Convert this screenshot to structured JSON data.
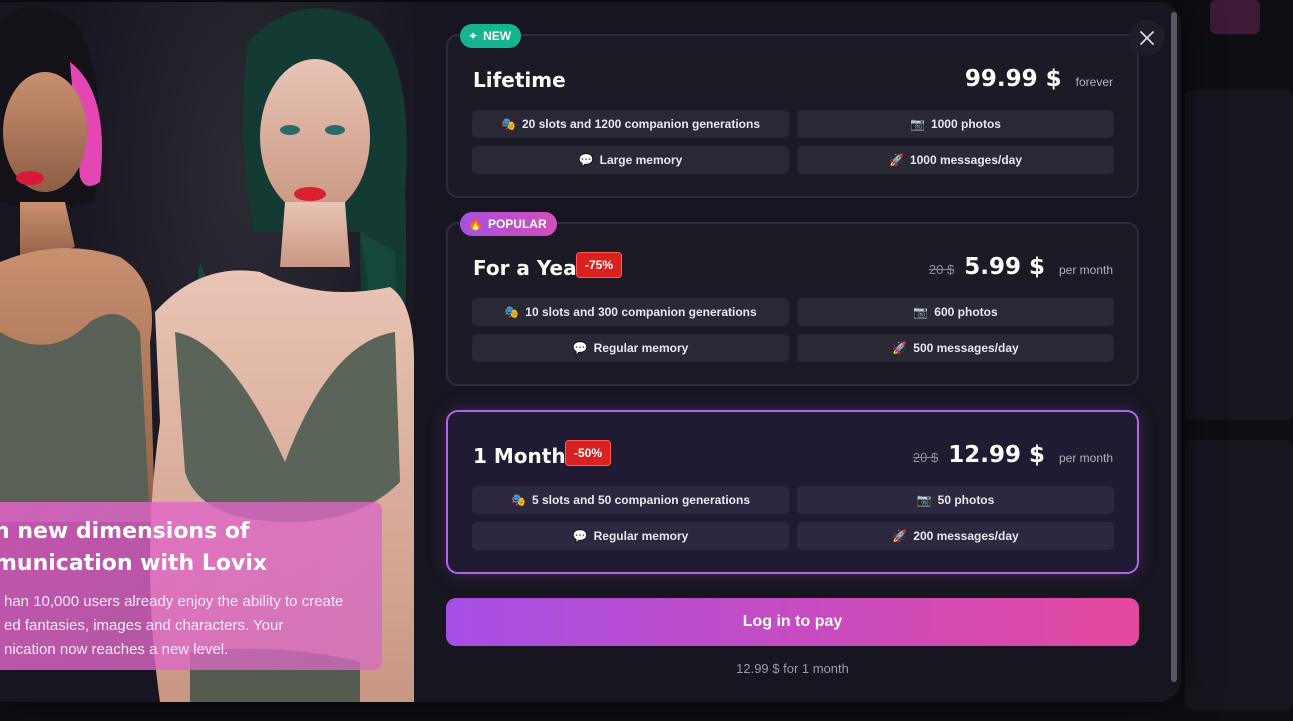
{
  "hero": {
    "title": "n new dimensions of\nmunication with Lovix",
    "text": "han 10,000 users already enjoy the ability to create\ned fantasies, images and characters. Your\nnication now reaches a new level."
  },
  "plans": [
    {
      "badge": "NEW",
      "badge_icon": "sparkle-icon",
      "name": "Lifetime",
      "discount": "",
      "old_price": "",
      "price": "99.99 $",
      "period": "forever",
      "features": [
        {
          "icon": "masks-icon",
          "label": "20 slots and 1200 companion generations"
        },
        {
          "icon": "camera-icon",
          "label": "1000 photos"
        },
        {
          "icon": "chat-icon",
          "label": "Large memory"
        },
        {
          "icon": "rocket-icon",
          "label": "1000 messages/day"
        }
      ]
    },
    {
      "badge": "POPULAR",
      "badge_icon": "fire-icon",
      "name": "For a Year",
      "discount": "-75%",
      "old_price": "20 $",
      "price": "5.99 $",
      "period": "per month",
      "features": [
        {
          "icon": "masks-icon",
          "label": "10 slots and 300 companion generations"
        },
        {
          "icon": "camera-icon",
          "label": "600 photos"
        },
        {
          "icon": "chat-icon",
          "label": "Regular memory"
        },
        {
          "icon": "rocket-icon",
          "label": "500 messages/day"
        }
      ]
    },
    {
      "badge": "",
      "name": "1 Month",
      "discount": "-50%",
      "old_price": "20 $",
      "price": "12.99 $",
      "period": "per month",
      "features": [
        {
          "icon": "masks-icon",
          "label": "5 slots and 50 companion generations"
        },
        {
          "icon": "camera-icon",
          "label": "50 photos"
        },
        {
          "icon": "chat-icon",
          "label": "Regular memory"
        },
        {
          "icon": "rocket-icon",
          "label": "200 messages/day"
        }
      ]
    }
  ],
  "pay_button": "Log in to pay",
  "pay_note": "12.99 $ for 1 month",
  "selected_plan": "1 Month",
  "colors": {
    "accent_start": "#a64fe6",
    "accent_end": "#e4489e",
    "new_badge": "#16b58f",
    "discount": "#d9221f",
    "selected_border": "#b066e8"
  }
}
